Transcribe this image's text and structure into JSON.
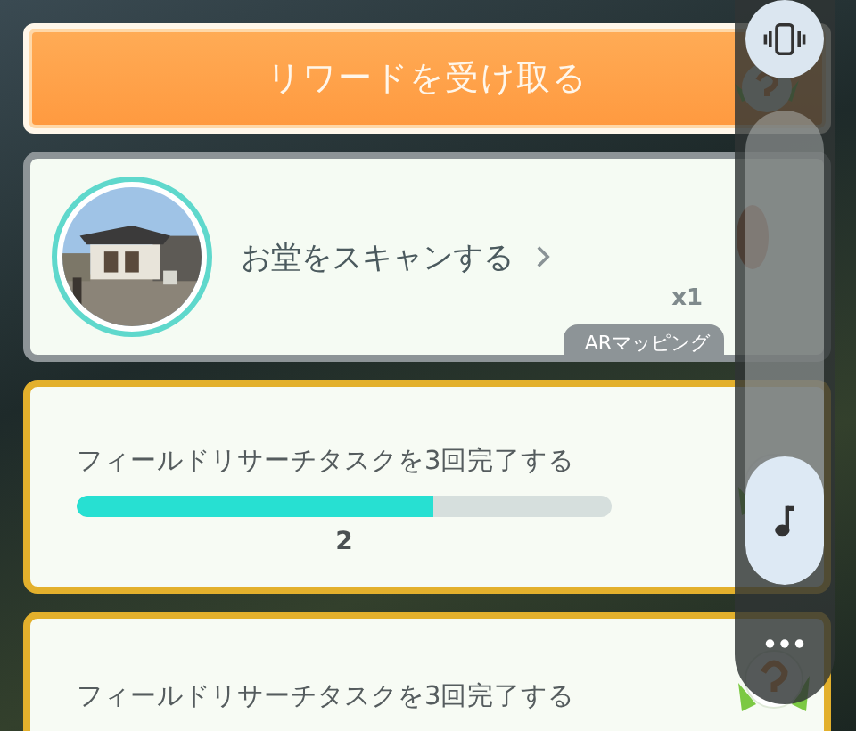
{
  "reward_button": {
    "label": "リワードを受け取る"
  },
  "scan_task": {
    "label": "お堂をスキャンする",
    "count": "x1",
    "tag": "ARマッピング"
  },
  "research_tasks": [
    {
      "label": "フィールドリサーチタスクを3回完了する",
      "level": 0.667,
      "progress": "2"
    },
    {
      "label": "フィールドリサーチタスクを3回完了する"
    }
  ],
  "side_controls": {
    "level": 0.27
  }
}
